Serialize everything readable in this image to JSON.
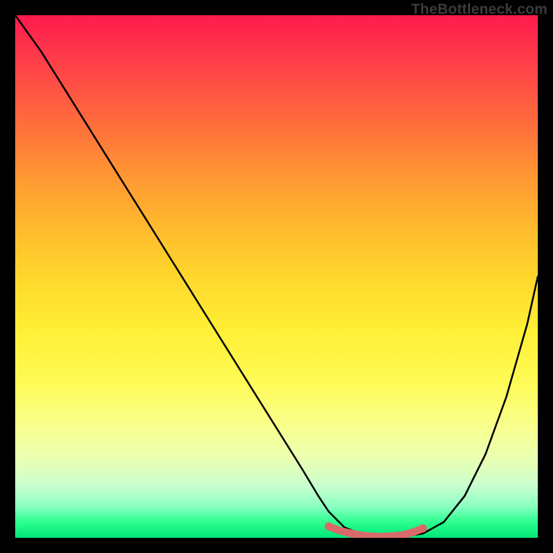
{
  "watermark": "TheBottleneck.com",
  "colors": {
    "frame": "#000000",
    "curve": "#000000",
    "markers": "#d96a6a",
    "gradient_top": "#ff1a4d",
    "gradient_mid": "#ffee35",
    "gradient_bottom": "#00e676"
  },
  "chart_data": {
    "type": "line",
    "title": "",
    "xlabel": "",
    "ylabel": "",
    "xlim": [
      0,
      100
    ],
    "ylim": [
      0,
      100
    ],
    "grid": false,
    "legend": false,
    "series": [
      {
        "name": "curve",
        "x": [
          0,
          5,
          10,
          15,
          20,
          25,
          30,
          35,
          40,
          45,
          50,
          55,
          58,
          60,
          63,
          66,
          70,
          74,
          78,
          82,
          86,
          90,
          94,
          98,
          100
        ],
        "values": [
          100,
          93,
          85,
          77,
          69,
          61,
          53,
          45,
          37,
          29,
          21,
          13,
          8,
          5,
          2,
          0.8,
          0.2,
          0.2,
          0.8,
          3,
          8,
          16,
          27,
          41,
          50
        ]
      }
    ],
    "markers": {
      "name": "flat-region",
      "x": [
        60,
        62,
        64,
        66,
        68,
        70,
        72,
        74,
        76,
        78
      ],
      "values": [
        2.2,
        1.4,
        0.9,
        0.5,
        0.3,
        0.2,
        0.3,
        0.5,
        1.0,
        1.8
      ]
    },
    "background_gradient": {
      "direction": "vertical",
      "stops": [
        {
          "pos": 0,
          "color": "#ff1a4d"
        },
        {
          "pos": 50,
          "color": "#ffee35"
        },
        {
          "pos": 100,
          "color": "#00e676"
        }
      ],
      "meaning": "lower curve value = better (green), higher = worse (red)"
    }
  }
}
